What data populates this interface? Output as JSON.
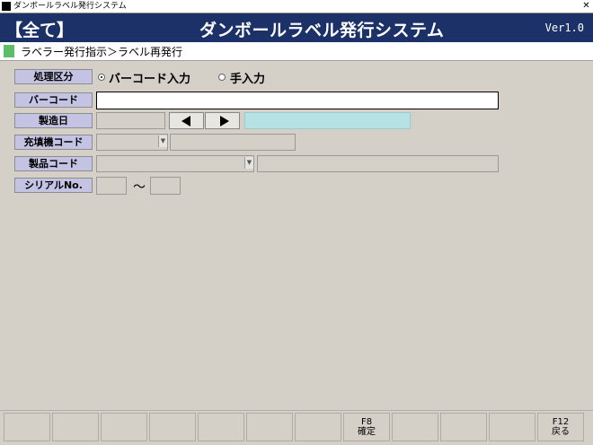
{
  "window": {
    "title": "ダンボールラベル発行システム",
    "close_glyph": "✕"
  },
  "header": {
    "scope": "【全て】",
    "system_title": "ダンボールラベル発行システム",
    "version": "Ver1.0"
  },
  "breadcrumb": {
    "text": "ラベラー発行指示＞ラベル再発行"
  },
  "form": {
    "process_type": {
      "label": "処理区分",
      "options": [
        "バーコード入力",
        "手入力"
      ],
      "selected": "バーコード入力"
    },
    "barcode": {
      "label": "バーコード",
      "value": ""
    },
    "manufacture_date": {
      "label": "製造日",
      "value": "",
      "weekday_value": ""
    },
    "filler_code": {
      "label": "充填機コード",
      "value": "",
      "name_value": ""
    },
    "product_code": {
      "label": "製品コード",
      "value": "",
      "name_value": ""
    },
    "serial_no": {
      "label": "シリアルNo.",
      "from": "",
      "to": "",
      "range_separator": "～"
    }
  },
  "function_keys": [
    {
      "key": "",
      "label": ""
    },
    {
      "key": "",
      "label": ""
    },
    {
      "key": "",
      "label": ""
    },
    {
      "key": "",
      "label": ""
    },
    {
      "key": "",
      "label": ""
    },
    {
      "key": "",
      "label": ""
    },
    {
      "key": "",
      "label": ""
    },
    {
      "key": "F8",
      "label": "確定"
    },
    {
      "key": "",
      "label": ""
    },
    {
      "key": "",
      "label": ""
    },
    {
      "key": "",
      "label": ""
    },
    {
      "key": "F12",
      "label": "戻る"
    }
  ],
  "colors": {
    "banner": "#1d3169",
    "label_bg": "#c5c3e3",
    "breadcrumb_marker": "#5cbe67",
    "weekday_field": "#b6e2e6"
  }
}
